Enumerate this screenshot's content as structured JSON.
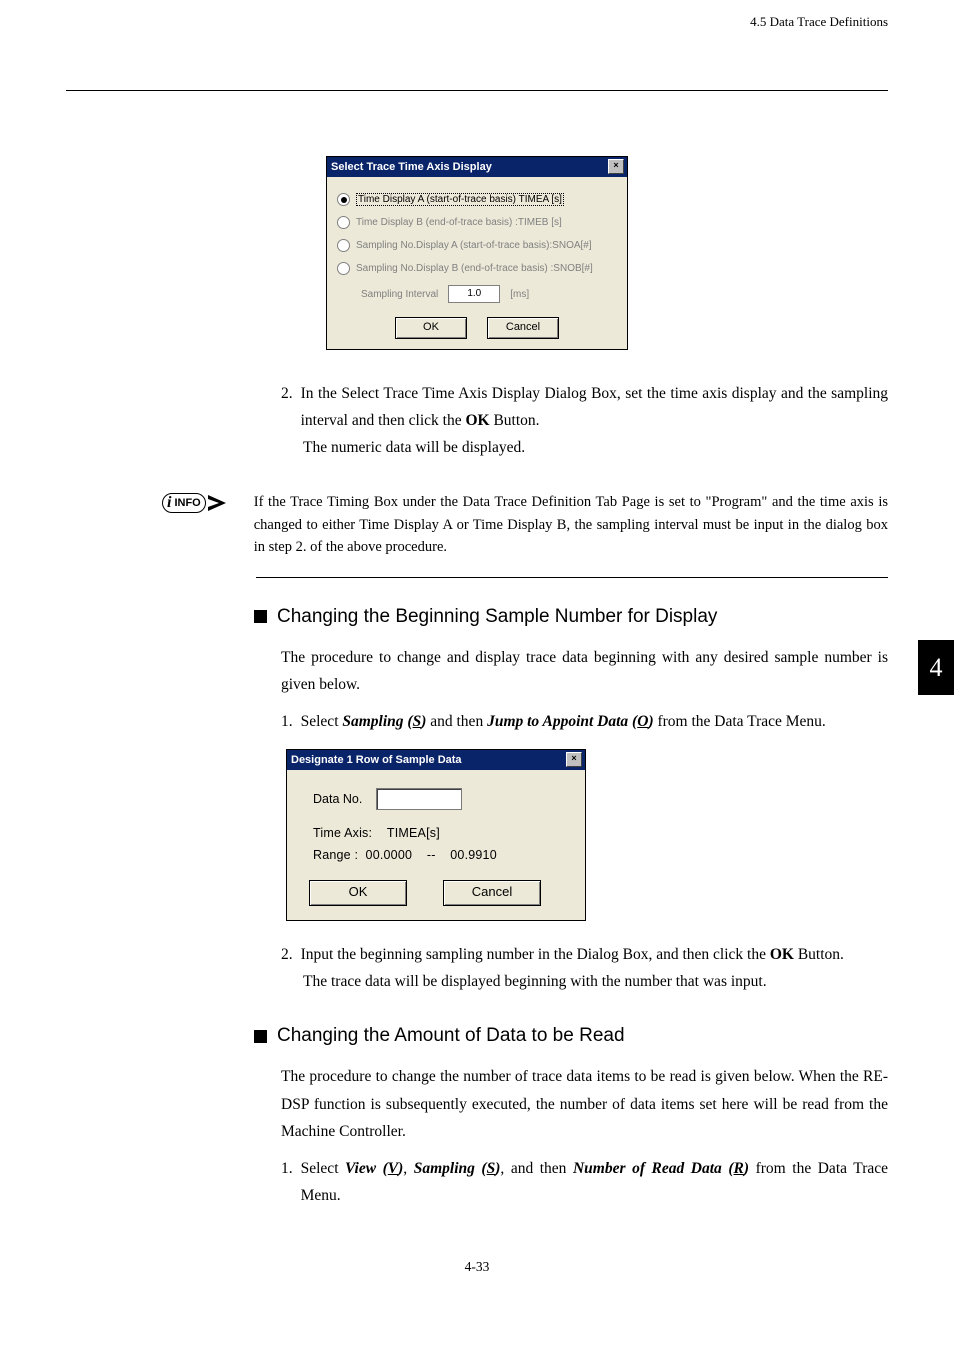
{
  "header": {
    "section_ref": "4.5  Data Trace Definitions"
  },
  "tab_badge": "4",
  "dialog1": {
    "title": "Select Trace Time Axis Display",
    "close": "×",
    "opt_a": "Time Display A (start-of-trace basis) TIMEA [s]",
    "opt_b": "Time Display B (end-of-trace basis)  :TIMEB [s]",
    "opt_c": "Sampling No.Display A (start-of-trace basis):SNOA[#]",
    "opt_d": "Sampling No.Display B (end-of-trace basis)  :SNOB[#]",
    "interval_label": "Sampling Interval",
    "interval_value": "1.0",
    "interval_unit": "[ms]",
    "ok": "OK",
    "cancel": "Cancel"
  },
  "step2": {
    "num": "2.",
    "line1a": "In the Select Trace Time Axis Display Dialog Box, set the time axis display and the sampling interval and then click the ",
    "ok_bold": "OK",
    "line1b": " Button.",
    "line2": "The numeric data will be displayed."
  },
  "info": {
    "label": "INFO",
    "text": "If the Trace Timing Box under the Data Trace Definition Tab Page is set to \"Program\" and the time axis is changed to either Time Display A or Time Display B, the sampling interval must be input in the dialog box in step 2. of the above procedure."
  },
  "sec1": {
    "title": "Changing the Beginning Sample Number for Display",
    "intro": "The procedure to change and display trace data beginning with any desired sample number is given below.",
    "step1_num": "1.",
    "step1_a": "Select ",
    "step1_s": "Sampling (",
    "step1_s_u": "S",
    "step1_s2": ")",
    "step1_mid": " and then ",
    "step1_j": "Jump to Appoint Data (",
    "step1_j_u": "O",
    "step1_j2": ")",
    "step1_end": " from the Data Trace Menu."
  },
  "dialog2": {
    "title": "Designate 1 Row of Sample Data",
    "close": "×",
    "datano_label": "Data No.",
    "timeaxis_label": "Time Axis:",
    "timeaxis_value": "TIMEA[s]",
    "range_label": "Range  :",
    "range_from": "00.0000",
    "range_sep": "--",
    "range_to": "00.9910",
    "ok": "OK",
    "cancel": "Cancel"
  },
  "sec1_step2": {
    "num": "2.",
    "line1a": "Input the beginning sampling number in the Dialog Box, and then click the ",
    "ok_bold": "OK",
    "line1b": " Button.",
    "line2": "The trace data will be displayed beginning with the number that was input."
  },
  "sec2": {
    "title": "Changing the Amount of Data to be Read",
    "intro": "The procedure to change the number of trace data items to be read is given below. When the RE-DSP function is subsequently executed, the number of data items set here will be read from the Machine Controller.",
    "step1_num": "1.",
    "s_a": "Select ",
    "s_view": "View (",
    "s_view_u": "V",
    "s_view2": ")",
    "s_c1": ", ",
    "s_samp": "Sampling (",
    "s_samp_u": "S",
    "s_samp2": ")",
    "s_c2": ", and then ",
    "s_num": "Number of Read Data (",
    "s_num_u": "R",
    "s_num2": ")",
    "s_end": " from the Data Trace Menu."
  },
  "footer": {
    "pagenum": "4-33"
  }
}
